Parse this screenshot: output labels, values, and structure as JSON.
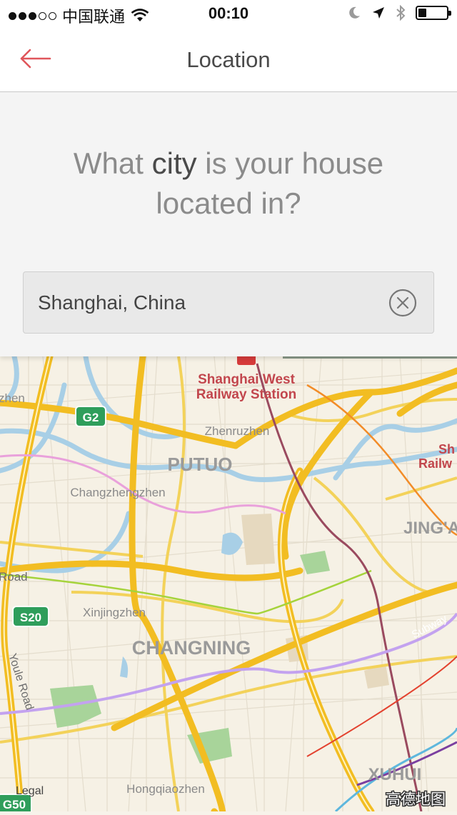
{
  "status_bar": {
    "carrier": "中国联通",
    "time": "00:10",
    "battery_level": 0.28
  },
  "nav": {
    "title": "Location"
  },
  "question": {
    "prefix": "What ",
    "highlight": "city",
    "suffix": " is your house located in?"
  },
  "city_input": {
    "value": "Shanghai, China"
  },
  "map": {
    "labels": {
      "station": "Shanghai West Railway Station",
      "station_line1": "Shanghai West",
      "station_line2": "Railway Station",
      "zhenruzhen": "Zhenruzhen",
      "putuo": "PUTUO",
      "changzhengzhen": "Changzhengzhen",
      "jingan": "JING'A",
      "xinjingzhen": "Xinjingzhen",
      "changning": "CHANGNING",
      "xuhui": "XUHUI",
      "hongqiaozhen": "Hongqiaozhen",
      "zhen_partial": "zhen",
      "road_partial": "Road",
      "youle_road": "Youle Road",
      "subway": "Subway",
      "sh_partial1": "Sh",
      "sh_partial2": "Railw",
      "legal": "Legal",
      "provider": "高德地图"
    },
    "shields": {
      "g2": "G2",
      "s20": "S20",
      "g50": "G50"
    }
  }
}
